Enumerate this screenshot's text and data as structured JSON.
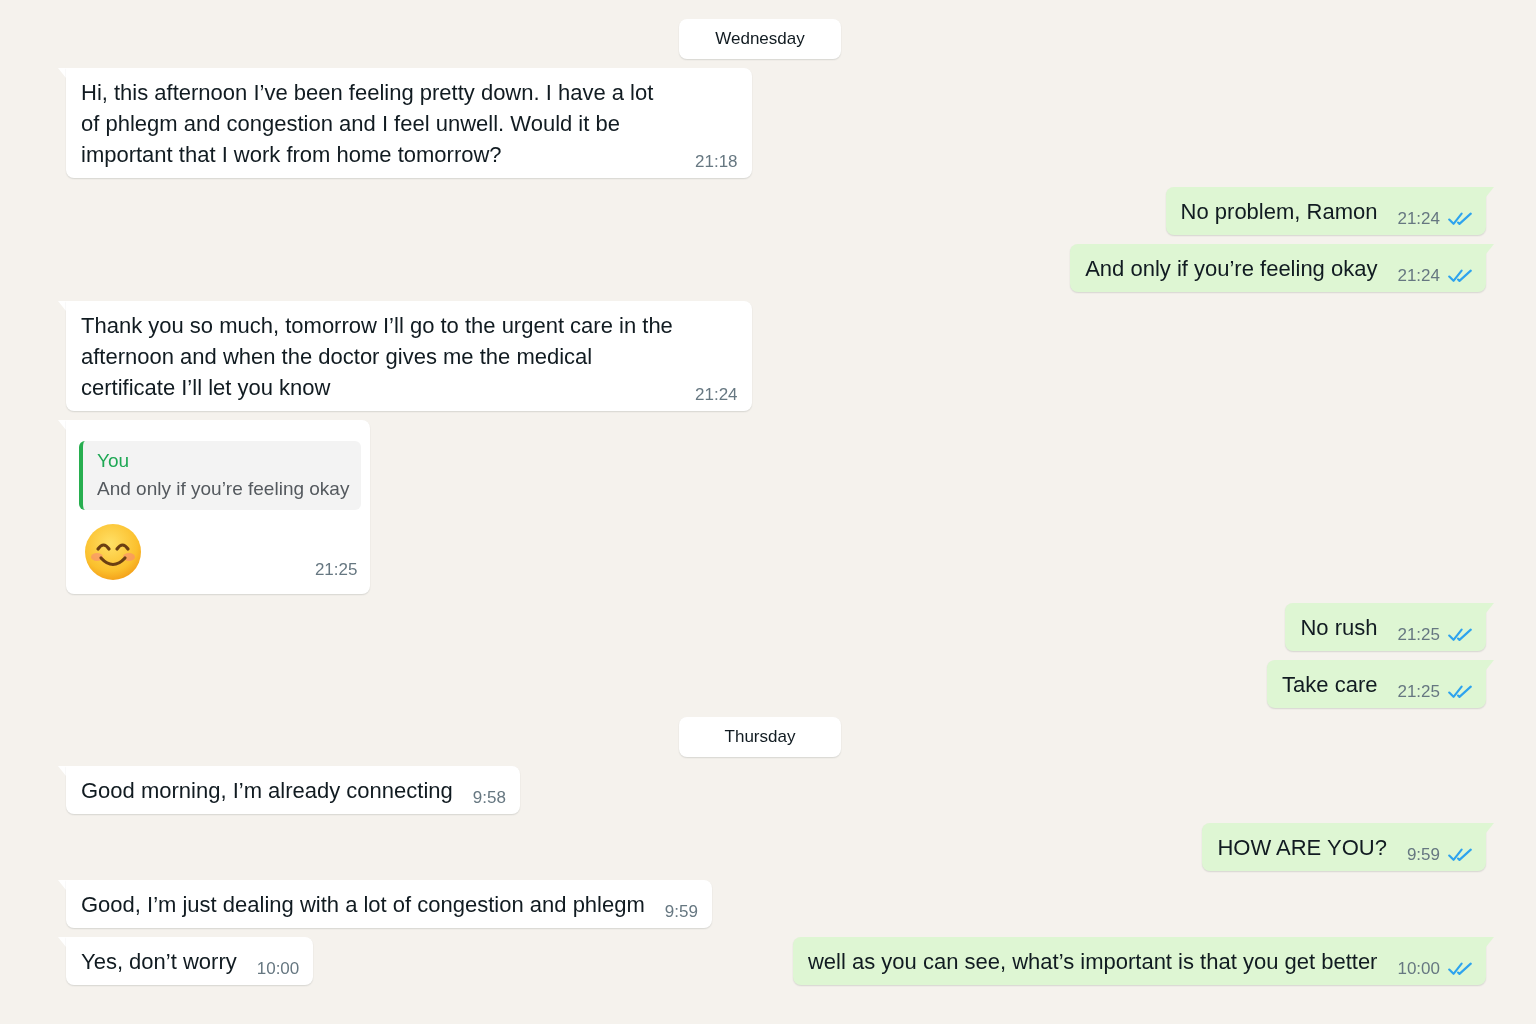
{
  "chat": [
    {
      "kind": "date",
      "label": "Wednesday"
    },
    {
      "kind": "incoming",
      "text": "Hi, this afternoon I’ve been feeling pretty down. I have a lot of phlegm and congestion and I feel unwell. Would it be important that I work from home tomorrow?",
      "time": "21:18"
    },
    {
      "kind": "outgoing",
      "text": "No problem, Ramon",
      "time": "21:24",
      "read": true
    },
    {
      "kind": "outgoing",
      "text": "And only if you’re feeling okay",
      "time": "21:24",
      "read": true
    },
    {
      "kind": "incoming",
      "text": "Thank you so much, tomorrow I’ll go to the urgent care in the afternoon and when the doctor gives me the medical certificate I’ll let you know",
      "time": "21:24"
    },
    {
      "kind": "incoming",
      "quote": {
        "author": "You",
        "text": "And only if you’re feeling okay"
      },
      "emoji": true,
      "time": "21:25"
    },
    {
      "kind": "outgoing",
      "text": "No rush",
      "time": "21:25",
      "read": true
    },
    {
      "kind": "outgoing",
      "text": "Take care",
      "time": "21:25",
      "read": true
    },
    {
      "kind": "date",
      "label": "Thursday"
    },
    {
      "kind": "incoming",
      "text": "Good morning, I’m already connecting",
      "time": "9:58"
    },
    {
      "kind": "outgoing",
      "text": "HOW ARE YOU?",
      "time": "9:59",
      "read": true
    },
    {
      "kind": "incoming",
      "text": "Good, I’m just dealing with a lot of congestion and phlegm",
      "time": "9:59"
    },
    {
      "kind": "row",
      "messages": [
        {
          "kind": "incoming",
          "text": "Yes, don’t worry",
          "time": "10:00"
        },
        {
          "kind": "outgoing",
          "text": "well as you can see, what’s important is that you get better",
          "time": "10:00",
          "read": true
        }
      ]
    }
  ]
}
